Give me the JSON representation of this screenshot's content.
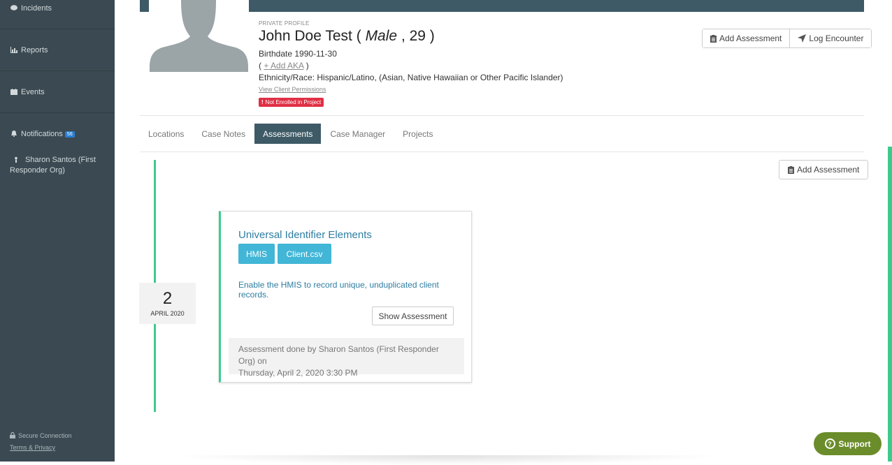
{
  "sidebar": {
    "items": [
      {
        "label": "Incidents",
        "icon": "comment-icon"
      },
      {
        "label": "Reports",
        "icon": "bar-chart-icon"
      },
      {
        "label": "Events",
        "icon": "calendar-icon"
      },
      {
        "label": "Notifications",
        "icon": "bell-icon",
        "badge": "56"
      },
      {
        "label": "Sharon Santos (First Responder Org)",
        "icon": "user-icon"
      }
    ],
    "secure": "Secure Connection",
    "terms": "Terms & Privacy"
  },
  "profile": {
    "private_label": "PRIVATE PROFILE",
    "name": "John Doe Test",
    "open_paren": "(",
    "gender": "Male",
    "age": ", 29 )",
    "birth_label": "Birthdate",
    "birth_value": "1990-11-30",
    "aka_open": "(",
    "aka_link": "+ Add AKA",
    "aka_close": ")",
    "eth_label": "Ethnicity/Race:",
    "eth_value": "Hispanic/Latino, (Asian, Native Hawaiian or Other Pacific Islander)",
    "permissions_link": "View Client Permissions",
    "not_enrolled": "Not Enrolled in Project"
  },
  "actions": {
    "add_assessment": "Add Assessment",
    "log_encounter": "Log Encounter"
  },
  "tabs": [
    {
      "label": "Locations",
      "active": false
    },
    {
      "label": "Case Notes",
      "active": false
    },
    {
      "label": "Assessments",
      "active": true
    },
    {
      "label": "Case Manager",
      "active": false
    },
    {
      "label": "Projects",
      "active": false
    }
  ],
  "timeline": {
    "add_assessment": "Add Assessment",
    "date_day": "2",
    "date_month": "APRIL 2020"
  },
  "card": {
    "title": "Universal Identifier Elements",
    "tags": [
      "HMIS",
      "Client.csv"
    ],
    "description": "Enable the HMIS to record unique, unduplicated client records.",
    "show_button": "Show Assessment",
    "footer_line1": "Assessment done by Sharon Santos (First Responder Org) on",
    "footer_line2": "Thursday, April 2, 2020 3:30 PM"
  },
  "support": "Support",
  "colors": {
    "sidebar_bg": "#3b4a52",
    "accent_dark": "#3d5a66",
    "timeline_green": "#3dcb8c",
    "tag_blue": "#42b6d6",
    "link_blue": "#2d7da2",
    "alert_red": "#e02f45",
    "support_green": "#6b8c2a"
  }
}
